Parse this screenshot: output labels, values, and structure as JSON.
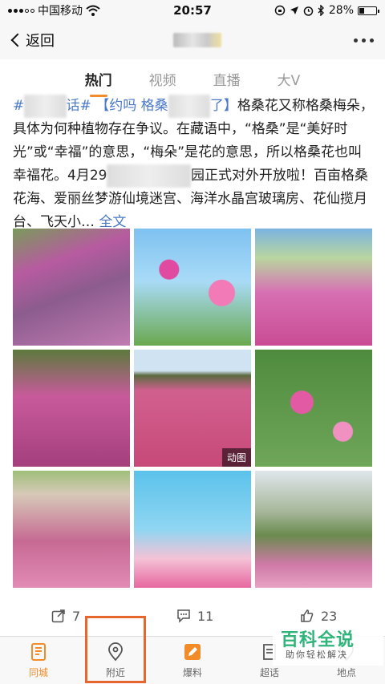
{
  "status_bar": {
    "carrier": "中国移动",
    "time": "20:57",
    "battery_pct": "28%",
    "battery_fraction": 0.28
  },
  "nav": {
    "back_label": "返回"
  },
  "tabs": [
    {
      "label": "热门",
      "active": true
    },
    {
      "label": "视频",
      "active": false
    },
    {
      "label": "直播",
      "active": false
    },
    {
      "label": "大V",
      "active": false
    }
  ],
  "post": {
    "hashtag": "#",
    "hashtag_tail": "话#",
    "bracket_open": "【约吗",
    "bracket_mid": "格桑",
    "bracket_close": "了】",
    "text1": "格桑花又称格桑梅朵，具体为何种植物存在争议。在藏语中，“格桑”是“美好时光”或“幸福”的意思，“梅朵”是花的意思，所以格桑花也叫幸福花。4月29",
    "text2": "园正式对外开放啦！百亩格桑花海、爱丽丝梦游仙境迷宫、海洋水晶宫玻璃房、花仙揽月台、飞天小…",
    "full_text_link": "全文"
  },
  "images": [
    {
      "name": "photo-1",
      "badge": ""
    },
    {
      "name": "photo-2",
      "badge": ""
    },
    {
      "name": "photo-3",
      "badge": ""
    },
    {
      "name": "photo-4",
      "badge": ""
    },
    {
      "name": "photo-5",
      "badge": "动图"
    },
    {
      "name": "photo-6",
      "badge": ""
    },
    {
      "name": "photo-7",
      "badge": ""
    },
    {
      "name": "photo-8",
      "badge": ""
    },
    {
      "name": "photo-9",
      "badge": ""
    }
  ],
  "actions": {
    "repost_count": "7",
    "comment_count": "11",
    "like_count": "23"
  },
  "bottom_tabs": [
    {
      "label": "同城",
      "icon": "city-icon",
      "active": true
    },
    {
      "label": "附近",
      "icon": "location-pin-icon",
      "active": false
    },
    {
      "label": "爆料",
      "icon": "edit-icon",
      "active": false
    },
    {
      "label": "超话",
      "icon": "topic-icon",
      "active": false
    },
    {
      "label": "地点",
      "icon": "place-icon",
      "active": false
    }
  ],
  "watermark": {
    "title": "百科全说",
    "subtitle": "助你轻松解决"
  },
  "colors": {
    "accent": "#f28c28",
    "link": "#4a79c7",
    "highlight_box": "#e7662e"
  }
}
